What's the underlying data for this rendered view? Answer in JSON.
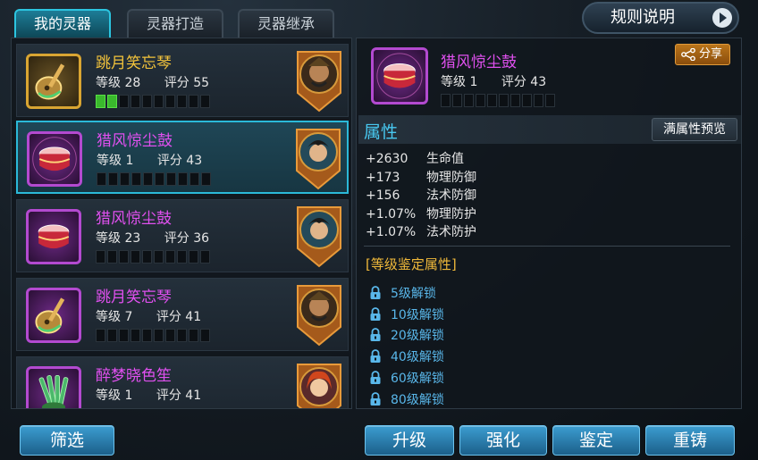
{
  "tabs": [
    {
      "label": "我的灵器",
      "active": true
    },
    {
      "label": "灵器打造",
      "active": false
    },
    {
      "label": "灵器继承",
      "active": false
    }
  ],
  "rules_button": {
    "label": "规则说明",
    "icon": "play-icon"
  },
  "list": [
    {
      "name": "跳月笑忘琴",
      "quality": "gold",
      "level_label": "等级",
      "level": "28",
      "score_label": "评分",
      "score": "55",
      "stars_filled": 2,
      "stars_total": 10,
      "icon": "pipa-icon",
      "hero": "warrior-portrait"
    },
    {
      "name": "猎风惊尘鼓",
      "quality": "purple",
      "level_label": "等级",
      "level": "1",
      "score_label": "评分",
      "score": "43",
      "stars_filled": 0,
      "stars_total": 10,
      "icon": "drum-icon",
      "hero": "swordsman-portrait",
      "selected": true
    },
    {
      "name": "猎风惊尘鼓",
      "quality": "purple",
      "level_label": "等级",
      "level": "23",
      "score_label": "评分",
      "score": "36",
      "stars_filled": 0,
      "stars_total": 10,
      "icon": "drum-icon",
      "hero": "swordsman-portrait"
    },
    {
      "name": "跳月笑忘琴",
      "quality": "purple",
      "level_label": "等级",
      "level": "7",
      "score_label": "评分",
      "score": "41",
      "stars_filled": 0,
      "stars_total": 10,
      "icon": "pipa-icon",
      "hero": "warrior-portrait"
    },
    {
      "name": "醉梦晓色笙",
      "quality": "purple",
      "level_label": "等级",
      "level": "1",
      "score_label": "评分",
      "score": "41",
      "stars_filled": 0,
      "stars_total": 10,
      "icon": "sheng-icon",
      "hero": "heroine-portrait"
    }
  ],
  "detail": {
    "name": "猎风惊尘鼓",
    "level_label": "等级",
    "level": "1",
    "score_label": "评分",
    "score": "43",
    "stars_filled": 0,
    "stars_total": 10,
    "icon": "drum-icon",
    "share_label": "分享",
    "attr_title": "属性",
    "preview_label": "满属性预览",
    "attributes": [
      {
        "value": "+2630",
        "name": "生命值"
      },
      {
        "value": "+173",
        "name": "物理防御"
      },
      {
        "value": "+156",
        "name": "法术防御"
      },
      {
        "value": "+1.07%",
        "name": "物理防护"
      },
      {
        "value": "+1.07%",
        "name": "法术防护"
      }
    ],
    "ident_title": "[等级鉴定属性]",
    "locks": [
      "5级解锁",
      "10级解锁",
      "20级解锁",
      "40级解锁",
      "60级解锁",
      "80级解锁"
    ]
  },
  "buttons": {
    "filter": "筛选",
    "upgrade": "升级",
    "enhance": "强化",
    "identify": "鉴定",
    "reforge": "重铸"
  },
  "colors": {
    "gold_name": "#f1c23b",
    "purple_name": "#e050ef",
    "accent_cyan": "#2bb9d8",
    "lock_blue": "#59b7ea",
    "star_green": "#3ab92d"
  }
}
